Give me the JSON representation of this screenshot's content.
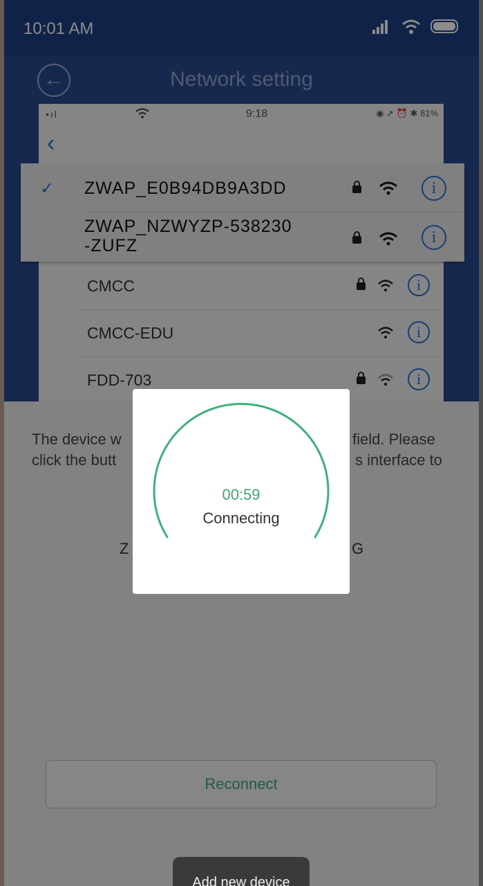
{
  "status_bar": {
    "time": "10:01 AM"
  },
  "header": {
    "title": "Network setting"
  },
  "embedded_screenshot": {
    "status": {
      "signal": "•ıl",
      "time": "9:18",
      "right": "◉ ➚ ⏰ ✱ 81%"
    },
    "networks": [
      {
        "name": "ZWAP_E0B94DB9A3DD",
        "selected": true,
        "locked": true
      },
      {
        "name_line1": "ZWAP_NZWYZP-538230",
        "name_line2": "-ZUFZ",
        "locked": true
      },
      {
        "name": "CMCC",
        "locked": true
      },
      {
        "name": "CMCC-EDU",
        "locked": false
      },
      {
        "name": "FDD-703",
        "locked": true
      }
    ]
  },
  "description": {
    "line1_start": "The device w",
    "line1_end": "field. Please",
    "line2_start": "click the butt",
    "line2_end": "s interface to"
  },
  "code": {
    "left": "Z",
    "right": "G"
  },
  "reconnect_label": "Reconnect",
  "dialog": {
    "countdown": "00:59",
    "label": "Connecting",
    "ring_color": "#3fb07a"
  },
  "toast": "Add new device",
  "colors": {
    "header_blue": "#1e3f82",
    "link_blue": "#2a6fd6",
    "green": "#3fa672"
  }
}
